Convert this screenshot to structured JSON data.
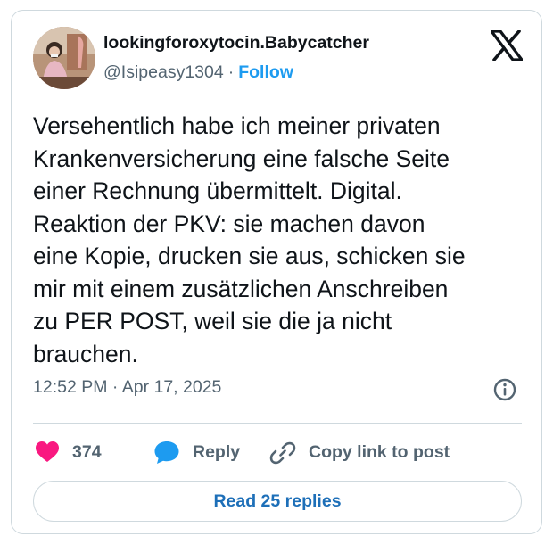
{
  "author": {
    "display_name": "lookingforoxytocin.Babycatcher",
    "handle": "@Isipeasy1304",
    "separator": "·",
    "follow_label": "Follow"
  },
  "tweet": {
    "text": "Versehentlich habe ich meiner privaten\nKrankenversicherung eine falsche Seite\neiner Rechnung übermittelt. Digital.\nReaktion der PKV: sie machen davon\neine Kopie, drucken sie aus, schicken sie\nmir mit einem zusätzlichen Anschreiben\nzu PER POST, weil sie die ja nicht\nbrauchen.",
    "timestamp": "12:52 PM · Apr 17, 2025"
  },
  "actions": {
    "like_count": "374",
    "reply_label": "Reply",
    "copy_link_label": "Copy link to post"
  },
  "footer": {
    "read_replies_label": "Read 25 replies"
  },
  "icons": {
    "platform_logo": "x-logo-icon",
    "info": "info-icon",
    "like": "heart-icon",
    "reply": "speech-bubble-icon",
    "copy_link": "link-icon"
  },
  "colors": {
    "like": "#f91880",
    "reply": "#1d9bf0",
    "link": "#1d9bf0",
    "muted": "#536471",
    "text": "#0f1419",
    "border": "#cfd9de"
  }
}
